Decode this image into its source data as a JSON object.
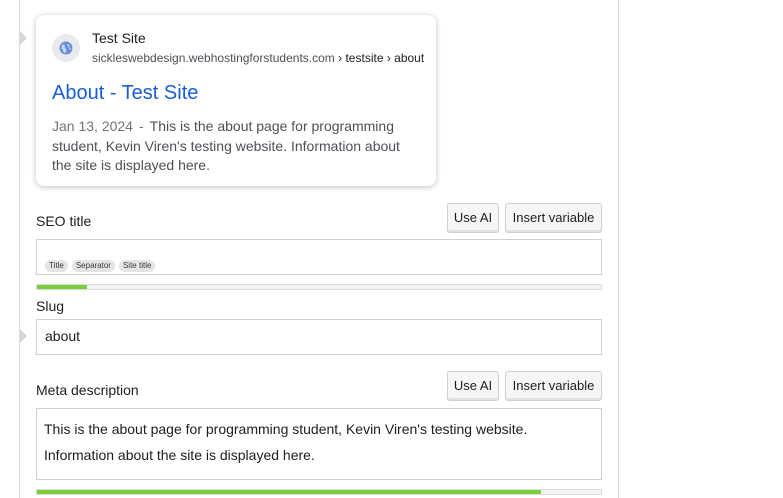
{
  "preview": {
    "site_name": "Test Site",
    "url_domain": "sickleswebdesign.webhostingforstudents.com",
    "url_crumbs": "› testsite › about",
    "title": "About - Test Site",
    "date": "Jan 13, 2024",
    "separator": "-",
    "description": "This is the about page for programming student, Kevin Viren's testing website. Information about the site is displayed here.",
    "favicon_icon": "globe-icon"
  },
  "seo_title": {
    "label": "SEO title",
    "use_ai_label": "Use AI",
    "insert_variable_label": "Insert variable",
    "variables": [
      "Title",
      "Separator",
      "Site title"
    ],
    "progress_fraction": 0.088,
    "progress_color": "#7ad03a"
  },
  "slug": {
    "label": "Slug",
    "value": "about"
  },
  "meta_description": {
    "label": "Meta description",
    "use_ai_label": "Use AI",
    "insert_variable_label": "Insert variable",
    "value": "This is the about page for programming student, Kevin Viren's testing website. Information about the site is displayed here.",
    "progress_fraction": 0.893,
    "progress_color": "#7ad03a"
  }
}
